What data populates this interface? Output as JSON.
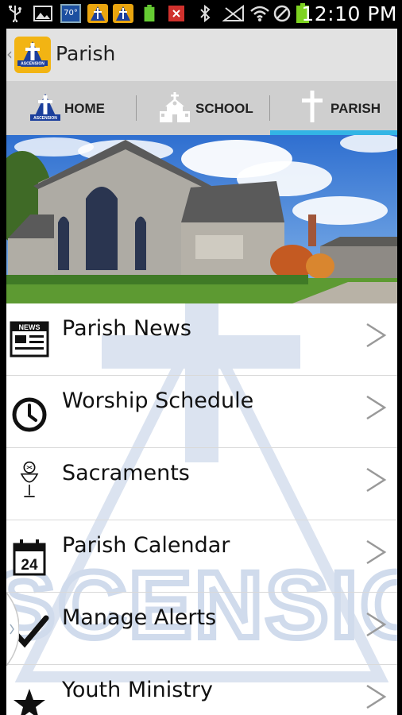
{
  "status_bar": {
    "temperature": "70°",
    "time": "12:10 PM"
  },
  "app": {
    "title": "Parish",
    "logo": "ascension-logo-icon"
  },
  "tabs": [
    {
      "label": "HOME",
      "icon": "ascension-logo-icon",
      "selected": false
    },
    {
      "label": "SCHOOL",
      "icon": "school-building-icon",
      "selected": false
    },
    {
      "label": "PARISH",
      "icon": "cross-icon",
      "selected": true
    }
  ],
  "menu": [
    {
      "label": "Parish News",
      "icon": "news-icon"
    },
    {
      "label": "Worship Schedule",
      "icon": "clock-icon"
    },
    {
      "label": "Sacraments",
      "icon": "chalice-icon"
    },
    {
      "label": "Parish Calendar",
      "icon": "calendar-icon",
      "icon_text": "24"
    },
    {
      "label": "Manage Alerts",
      "icon": "checkmark-icon"
    },
    {
      "label": "Youth Ministry",
      "icon": "star-icon"
    }
  ],
  "watermark_text": "SCENSIO",
  "colors": {
    "tab_indicator": "#33b5e5",
    "logo_gold": "#f2b413",
    "logo_blue": "#1c3f9c",
    "watermark": "#dbe3f0"
  }
}
